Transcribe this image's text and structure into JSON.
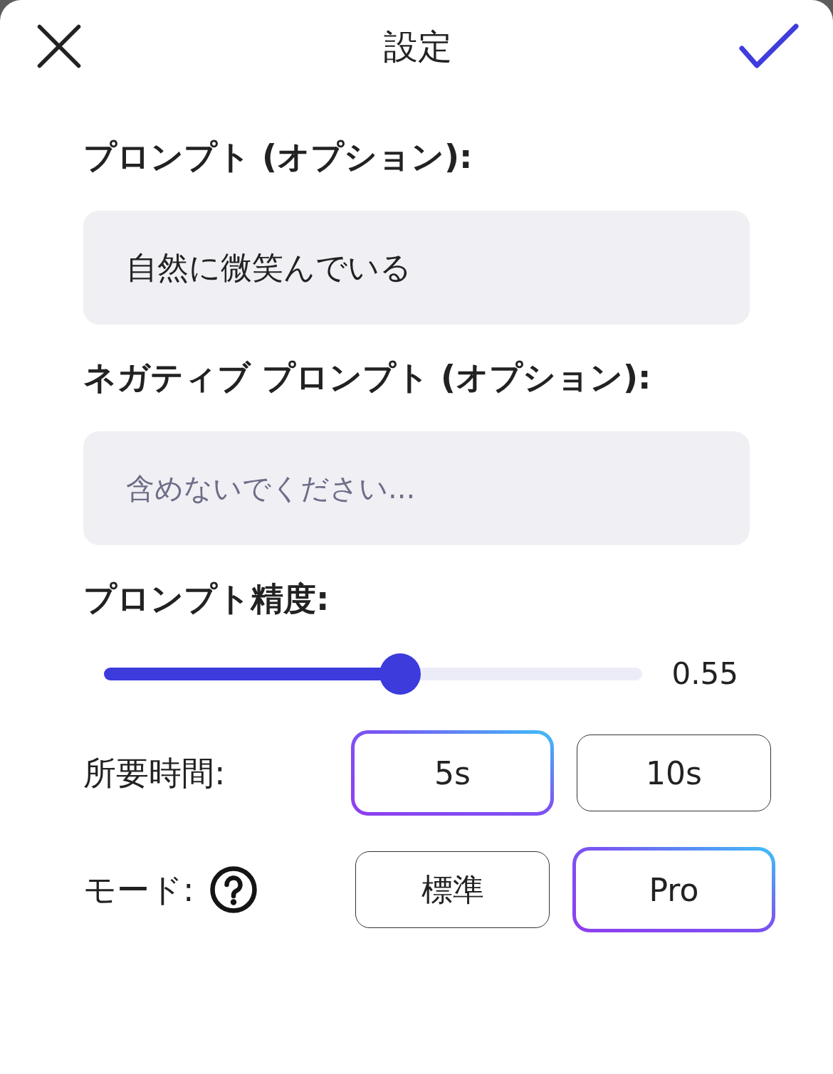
{
  "header": {
    "title": "設定"
  },
  "fields": [
    {
      "label": "プロンプト (オプション):",
      "value": "自然に微笑んでいる"
    },
    {
      "label": "ネガティブ プロンプト (オプション):",
      "placeholder": "含めないでください..."
    }
  ],
  "strength": {
    "label": "プロンプト精度:",
    "level": 0.55,
    "reading": "0.55"
  },
  "options": [
    {
      "label": "所要時間:",
      "help": false,
      "choices": [
        {
          "label": "5s",
          "selected": true
        },
        {
          "label": "10s",
          "selected": false
        }
      ]
    },
    {
      "label": "モード:",
      "help": true,
      "choices": [
        {
          "label": "標準",
          "selected": false
        },
        {
          "label": "Pro",
          "selected": true
        }
      ]
    }
  ]
}
